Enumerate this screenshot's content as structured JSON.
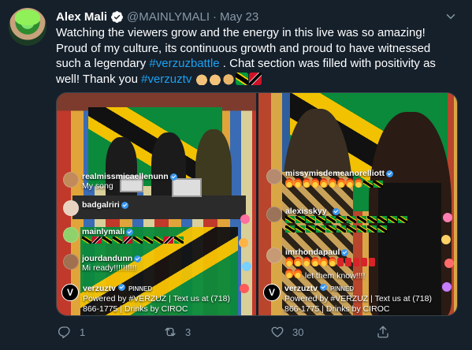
{
  "tweet": {
    "author_name": "Alex Mali",
    "handle": "@MAINLYMALI",
    "separator": "·",
    "date": "May 23",
    "text_before_tag": "Watching the viewers grow and the energy in this live was so amazing! Proud of my culture, its continuous growth and proud to have witnessed such a legendary ",
    "hashtag_1": "#verzuzbattle",
    "text_middle": " . Chat section was filled with positivity as well! Thank you ",
    "hashtag_2": "#verzuztv",
    "emojis": [
      "folded-hands",
      "folded-hands",
      "raising-hands",
      "flag-jamaica",
      "flag-trinidad-tobago"
    ]
  },
  "media": {
    "left_panel": {
      "comments": [
        {
          "user": "realmissmicaellenunn",
          "message": "My song"
        },
        {
          "user": "badgalriri",
          "message": ""
        },
        {
          "user": "mainlymali",
          "message": ""
        },
        {
          "user": "jourdandunn",
          "message": "Mi ready!!!!!!!!!!"
        }
      ],
      "pinned": {
        "user": "verzuztv",
        "pinned_label": "PINNED",
        "text_1": "Powered by #VERZUZ | Text us at (718)",
        "text_2": "866-1775 | Drinks by CIROC"
      }
    },
    "right_panel": {
      "comments": [
        {
          "user": "missymisdemeanorelliott",
          "message": ""
        },
        {
          "user": "alexisskyy_",
          "message": ""
        },
        {
          "user": "imrhondapaul",
          "message": "let them know!!!!"
        }
      ],
      "pinned": {
        "user": "verzuztv",
        "pinned_label": "PINNED",
        "text_1": "Powered by #VERZUZ | Text us at (718)",
        "text_2": "866-1775 | Drinks by CIROC"
      }
    }
  },
  "actions": {
    "reply_count": "1",
    "retweet_count": "3",
    "like_count": "30"
  },
  "colors": {
    "background": "#15202b",
    "secondary_text": "#8899a6",
    "link": "#1da1f2",
    "verified": "#1da1f2"
  }
}
